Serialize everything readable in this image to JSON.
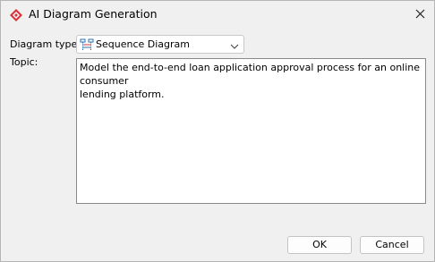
{
  "window": {
    "title": "AI Diagram Generation"
  },
  "form": {
    "diagram_type_label": "Diagram type:",
    "diagram_type_value": "Sequence Diagram",
    "topic_label": "Topic:",
    "topic_value": "Model the end-to-end loan application approval process for an online consumer\nlending platform."
  },
  "buttons": {
    "ok_label": "OK",
    "cancel_label": "Cancel"
  },
  "icons": {
    "app": "visual-paradigm-logo-icon",
    "close": "close-icon",
    "diagram_type": "sequence-diagram-icon",
    "dropdown": "chevron-down-icon"
  },
  "colors": {
    "accent": "#d9343b",
    "icon_blue": "#2b6fb6"
  }
}
